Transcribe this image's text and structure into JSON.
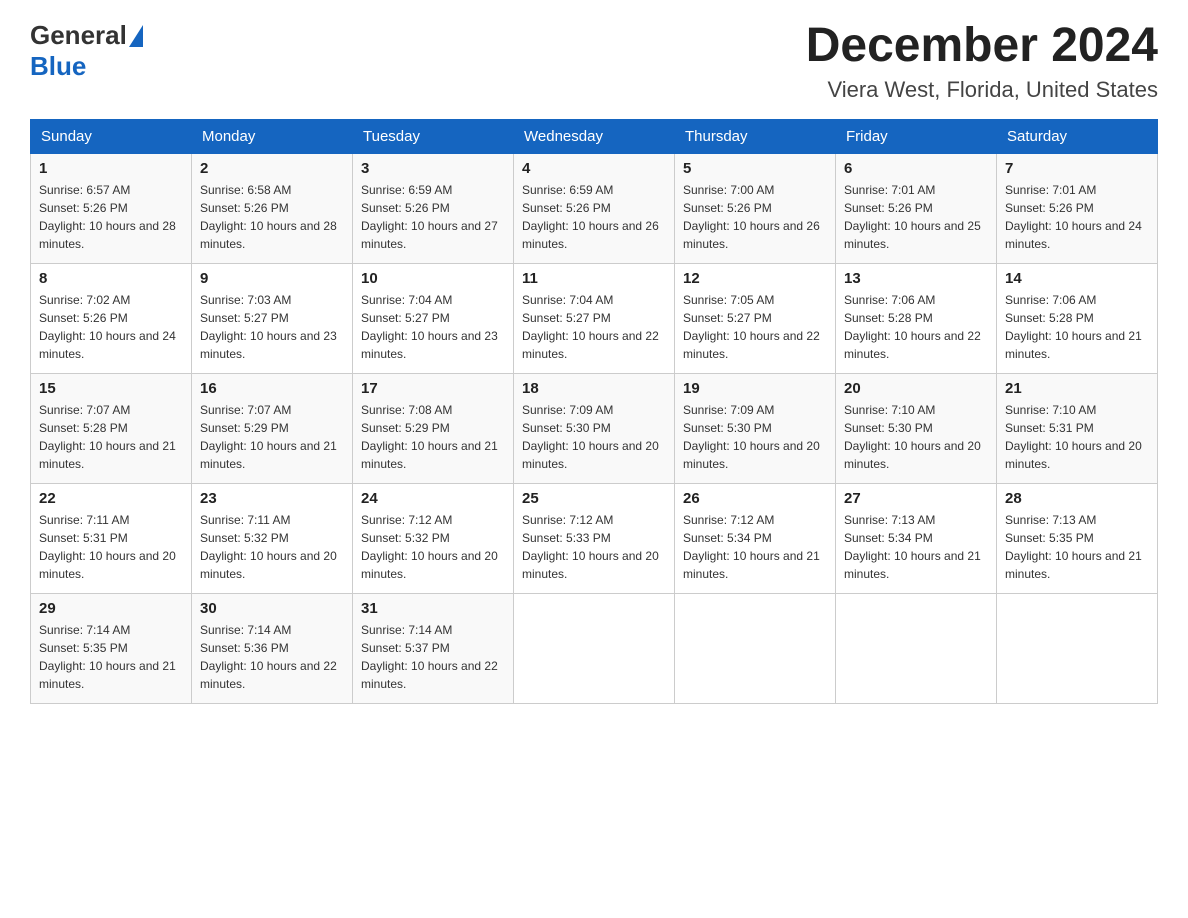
{
  "logo": {
    "general_text": "General",
    "blue_text": "Blue"
  },
  "title": "December 2024",
  "subtitle": "Viera West, Florida, United States",
  "weekdays": [
    "Sunday",
    "Monday",
    "Tuesday",
    "Wednesday",
    "Thursday",
    "Friday",
    "Saturday"
  ],
  "weeks": [
    [
      {
        "day": "1",
        "sunrise": "6:57 AM",
        "sunset": "5:26 PM",
        "daylight": "10 hours and 28 minutes."
      },
      {
        "day": "2",
        "sunrise": "6:58 AM",
        "sunset": "5:26 PM",
        "daylight": "10 hours and 28 minutes."
      },
      {
        "day": "3",
        "sunrise": "6:59 AM",
        "sunset": "5:26 PM",
        "daylight": "10 hours and 27 minutes."
      },
      {
        "day": "4",
        "sunrise": "6:59 AM",
        "sunset": "5:26 PM",
        "daylight": "10 hours and 26 minutes."
      },
      {
        "day": "5",
        "sunrise": "7:00 AM",
        "sunset": "5:26 PM",
        "daylight": "10 hours and 26 minutes."
      },
      {
        "day": "6",
        "sunrise": "7:01 AM",
        "sunset": "5:26 PM",
        "daylight": "10 hours and 25 minutes."
      },
      {
        "day": "7",
        "sunrise": "7:01 AM",
        "sunset": "5:26 PM",
        "daylight": "10 hours and 24 minutes."
      }
    ],
    [
      {
        "day": "8",
        "sunrise": "7:02 AM",
        "sunset": "5:26 PM",
        "daylight": "10 hours and 24 minutes."
      },
      {
        "day": "9",
        "sunrise": "7:03 AM",
        "sunset": "5:27 PM",
        "daylight": "10 hours and 23 minutes."
      },
      {
        "day": "10",
        "sunrise": "7:04 AM",
        "sunset": "5:27 PM",
        "daylight": "10 hours and 23 minutes."
      },
      {
        "day": "11",
        "sunrise": "7:04 AM",
        "sunset": "5:27 PM",
        "daylight": "10 hours and 22 minutes."
      },
      {
        "day": "12",
        "sunrise": "7:05 AM",
        "sunset": "5:27 PM",
        "daylight": "10 hours and 22 minutes."
      },
      {
        "day": "13",
        "sunrise": "7:06 AM",
        "sunset": "5:28 PM",
        "daylight": "10 hours and 22 minutes."
      },
      {
        "day": "14",
        "sunrise": "7:06 AM",
        "sunset": "5:28 PM",
        "daylight": "10 hours and 21 minutes."
      }
    ],
    [
      {
        "day": "15",
        "sunrise": "7:07 AM",
        "sunset": "5:28 PM",
        "daylight": "10 hours and 21 minutes."
      },
      {
        "day": "16",
        "sunrise": "7:07 AM",
        "sunset": "5:29 PM",
        "daylight": "10 hours and 21 minutes."
      },
      {
        "day": "17",
        "sunrise": "7:08 AM",
        "sunset": "5:29 PM",
        "daylight": "10 hours and 21 minutes."
      },
      {
        "day": "18",
        "sunrise": "7:09 AM",
        "sunset": "5:30 PM",
        "daylight": "10 hours and 20 minutes."
      },
      {
        "day": "19",
        "sunrise": "7:09 AM",
        "sunset": "5:30 PM",
        "daylight": "10 hours and 20 minutes."
      },
      {
        "day": "20",
        "sunrise": "7:10 AM",
        "sunset": "5:30 PM",
        "daylight": "10 hours and 20 minutes."
      },
      {
        "day": "21",
        "sunrise": "7:10 AM",
        "sunset": "5:31 PM",
        "daylight": "10 hours and 20 minutes."
      }
    ],
    [
      {
        "day": "22",
        "sunrise": "7:11 AM",
        "sunset": "5:31 PM",
        "daylight": "10 hours and 20 minutes."
      },
      {
        "day": "23",
        "sunrise": "7:11 AM",
        "sunset": "5:32 PM",
        "daylight": "10 hours and 20 minutes."
      },
      {
        "day": "24",
        "sunrise": "7:12 AM",
        "sunset": "5:32 PM",
        "daylight": "10 hours and 20 minutes."
      },
      {
        "day": "25",
        "sunrise": "7:12 AM",
        "sunset": "5:33 PM",
        "daylight": "10 hours and 20 minutes."
      },
      {
        "day": "26",
        "sunrise": "7:12 AM",
        "sunset": "5:34 PM",
        "daylight": "10 hours and 21 minutes."
      },
      {
        "day": "27",
        "sunrise": "7:13 AM",
        "sunset": "5:34 PM",
        "daylight": "10 hours and 21 minutes."
      },
      {
        "day": "28",
        "sunrise": "7:13 AM",
        "sunset": "5:35 PM",
        "daylight": "10 hours and 21 minutes."
      }
    ],
    [
      {
        "day": "29",
        "sunrise": "7:14 AM",
        "sunset": "5:35 PM",
        "daylight": "10 hours and 21 minutes."
      },
      {
        "day": "30",
        "sunrise": "7:14 AM",
        "sunset": "5:36 PM",
        "daylight": "10 hours and 22 minutes."
      },
      {
        "day": "31",
        "sunrise": "7:14 AM",
        "sunset": "5:37 PM",
        "daylight": "10 hours and 22 minutes."
      },
      null,
      null,
      null,
      null
    ]
  ],
  "labels": {
    "sunrise_prefix": "Sunrise: ",
    "sunset_prefix": "Sunset: ",
    "daylight_prefix": "Daylight: "
  },
  "colors": {
    "header_bg": "#1565c0",
    "header_text": "#ffffff",
    "accent_blue": "#1565c0"
  }
}
